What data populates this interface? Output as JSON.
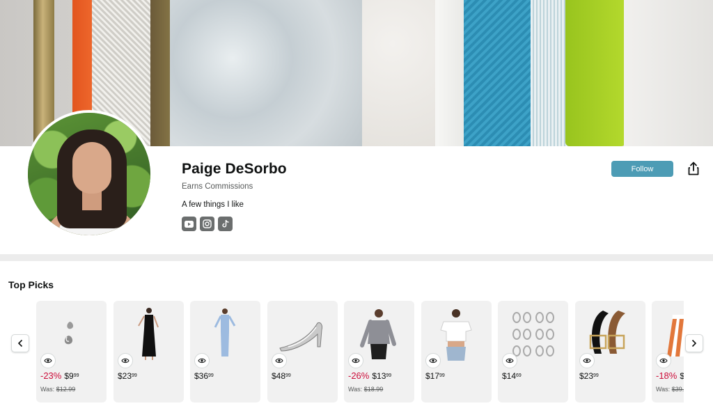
{
  "profile": {
    "name": "Paige DeSorbo",
    "earns": "Earns Commissions",
    "bio": "A few things I like",
    "socials": [
      {
        "icon": "youtube-icon"
      },
      {
        "icon": "instagram-icon"
      },
      {
        "icon": "tiktok-icon"
      }
    ],
    "follow_label": "Follow",
    "share_icon": "share-icon"
  },
  "top_picks": {
    "title": "Top Picks",
    "products": [
      {
        "name": "earrings",
        "discount": "-23%",
        "price_dollars": "$9",
        "price_cents": "99",
        "was_label": "Was:",
        "was_price": "$12.99"
      },
      {
        "name": "black maxi dress",
        "discount": "",
        "price_dollars": "$23",
        "price_cents": "99",
        "was_label": "",
        "was_price": ""
      },
      {
        "name": "blue maxi dress",
        "discount": "",
        "price_dollars": "$36",
        "price_cents": "99",
        "was_label": "",
        "was_price": ""
      },
      {
        "name": "silver heels",
        "discount": "",
        "price_dollars": "$48",
        "price_cents": "99",
        "was_label": "",
        "was_price": ""
      },
      {
        "name": "grey long sleeve top",
        "discount": "-26%",
        "price_dollars": "$13",
        "price_cents": "99",
        "was_label": "Was:",
        "was_price": "$18.99"
      },
      {
        "name": "white crop tee",
        "discount": "",
        "price_dollars": "$17",
        "price_cents": "99",
        "was_label": "",
        "was_price": ""
      },
      {
        "name": "hoop earrings set",
        "discount": "",
        "price_dollars": "$14",
        "price_cents": "69",
        "was_label": "",
        "was_price": ""
      },
      {
        "name": "leather belts",
        "discount": "",
        "price_dollars": "$23",
        "price_cents": "99",
        "was_label": "",
        "was_price": ""
      },
      {
        "name": "striped top",
        "discount": "-18%",
        "price_dollars": "$",
        "price_cents": "",
        "was_label": "Was:",
        "was_price": "$39."
      }
    ]
  },
  "colors": {
    "follow": "#4d9cb5",
    "discount": "#cc0c39",
    "card_bg": "#f1f1f1"
  }
}
